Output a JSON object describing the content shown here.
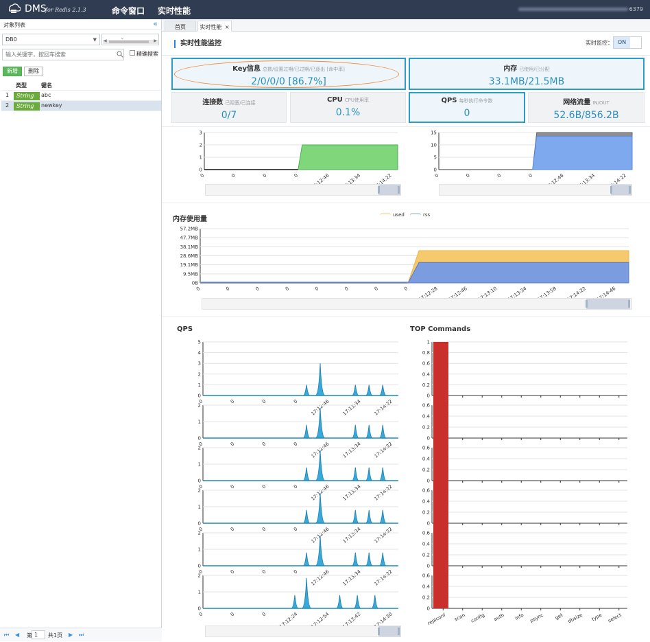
{
  "topbar": {
    "brand": "DMS",
    "brand_sub": "for Redis 2.1.3",
    "nav": [
      "命令窗口",
      "实时性能"
    ],
    "conn_suffix": "6379"
  },
  "sidebar": {
    "title": "对象列表",
    "collapse_icon": "double-chevron-left-icon",
    "db_value": "DB0",
    "search_placeholder": "输入关键字，按回车搜索",
    "exact_label": "精确搜索",
    "add_label": "新增",
    "delete_label": "删除",
    "columns": [
      "类型",
      "键名"
    ],
    "rows": [
      {
        "index": "1",
        "type": "String",
        "name": "abc"
      },
      {
        "index": "2",
        "type": "String",
        "name": "newkey"
      }
    ],
    "pager": {
      "page_prefix": "第",
      "page": "1",
      "total": "共1页"
    }
  },
  "tabs": [
    {
      "label": "首页"
    },
    {
      "label": "实时性能",
      "close": "×"
    }
  ],
  "main": {
    "title": "实时性能监控",
    "monitor_label": "实时监控：",
    "monitor_state": "ON",
    "cards": [
      {
        "title": "Key信息",
        "sub": "总数/设置过期/已过期/已逐出 [命中率]",
        "value": "2/0/0/0 [86.7%]"
      },
      {
        "title": "内存",
        "sub": "已使用/已分配",
        "value": "33.1MB/21.5MB"
      },
      {
        "title": "连接数",
        "sub": "已阻塞/已连接",
        "value": "0/7"
      },
      {
        "title": "CPU",
        "sub": "CPU使用率",
        "value": "0.1%"
      },
      {
        "title": "QPS",
        "sub": "每秒执行命令数",
        "value": "0"
      },
      {
        "title": "网络流量",
        "sub": "IN/OUT",
        "value": "52.6B/856.2B"
      }
    ],
    "memory_title": "内存使用量",
    "qps_title": "QPS",
    "top_title": "TOP Commands"
  },
  "chart_data": [
    {
      "type": "area",
      "name": "connections",
      "x": [
        "0",
        "0",
        "0",
        "0",
        "17:12:46",
        "17:13:34",
        "17:14:22"
      ],
      "values": [
        0,
        0,
        0,
        0,
        2,
        2,
        2
      ],
      "ylim": [
        0,
        3
      ],
      "yticks": [
        "0",
        "1",
        "2",
        "3"
      ],
      "color": "#7fd67b"
    },
    {
      "type": "area",
      "name": "cpu-network",
      "x": [
        "0",
        "0",
        "0",
        "0",
        "17:12:46",
        "17:13:34",
        "17:14:22"
      ],
      "series": [
        {
          "values": [
            0,
            0,
            0,
            0,
            15,
            15,
            15
          ],
          "color": "#8f8f8f"
        },
        {
          "values": [
            0,
            0,
            0,
            0,
            13.5,
            13.5,
            13.5
          ],
          "color": "#7fa9ee"
        }
      ],
      "ylim": [
        0,
        15
      ],
      "yticks": [
        "0",
        "5",
        "10",
        "15"
      ]
    },
    {
      "type": "area",
      "name": "memory",
      "x": [
        "0",
        "0",
        "0",
        "0",
        "0",
        "0",
        "0",
        "0",
        "17:12:28",
        "17:12:46",
        "17:13:10",
        "17:13:34",
        "17:13:58",
        "17:14:22",
        "17:14:46"
      ],
      "series": [
        {
          "name": "used",
          "values": [
            0,
            0,
            0,
            0,
            0,
            0,
            0,
            0,
            34,
            34,
            34,
            34,
            34,
            34,
            34
          ],
          "color": "#f5c96c"
        },
        {
          "name": "rss",
          "values": [
            0,
            0,
            0,
            0,
            0,
            0,
            0,
            0,
            21.5,
            21.5,
            21.5,
            21.5,
            21.5,
            21.5,
            21.5
          ],
          "color": "#7b9de0"
        }
      ],
      "yticks": [
        "0B",
        "9.5MB",
        "19.1MB",
        "28.6MB",
        "38.1MB",
        "47.7MB",
        "57.2MB"
      ],
      "ylim": [
        0,
        57.2
      ]
    },
    {
      "type": "area",
      "name": "qps-small-multiples",
      "x": [
        "0",
        "0",
        "0",
        "0",
        "17:12:46",
        "17:13:34",
        "17:14:22"
      ],
      "panels": [
        {
          "yticks": [
            "0",
            "1",
            "2",
            "3",
            "4",
            "5"
          ],
          "ymax": 5,
          "peaks": [
            [
              0.53,
              1
            ],
            [
              0.6,
              3
            ],
            [
              0.78,
              1
            ],
            [
              0.85,
              1
            ],
            [
              0.92,
              1
            ]
          ]
        },
        {
          "yticks": [
            "0",
            "1",
            "2"
          ],
          "ymax": 2.5,
          "peaks": [
            [
              0.53,
              1
            ],
            [
              0.6,
              2.3
            ],
            [
              0.78,
              1
            ],
            [
              0.85,
              1
            ],
            [
              0.92,
              1
            ]
          ]
        },
        {
          "yticks": [
            "0",
            "1",
            "2"
          ],
          "ymax": 2.5,
          "peaks": [
            [
              0.53,
              1
            ],
            [
              0.6,
              2.3
            ],
            [
              0.78,
              1
            ],
            [
              0.85,
              1
            ],
            [
              0.92,
              1
            ]
          ]
        },
        {
          "yticks": [
            "0",
            "1",
            "2"
          ],
          "ymax": 2.5,
          "peaks": [
            [
              0.53,
              1
            ],
            [
              0.6,
              2.3
            ],
            [
              0.78,
              1
            ],
            [
              0.85,
              1
            ],
            [
              0.92,
              1
            ]
          ]
        },
        {
          "yticks": [
            "0",
            "1",
            "2"
          ],
          "ymax": 2.5,
          "peaks": [
            [
              0.53,
              1
            ],
            [
              0.6,
              2.3
            ],
            [
              0.78,
              1
            ],
            [
              0.85,
              1
            ],
            [
              0.92,
              1
            ]
          ]
        },
        {
          "yticks": [
            "0",
            "1",
            "2"
          ],
          "ymax": 2.5,
          "x": [
            "0",
            "0",
            "0",
            "17:12:24",
            "17:12:54",
            "17:13:42",
            "17:14:30"
          ],
          "peaks": [
            [
              0.47,
              1
            ],
            [
              0.53,
              2.3
            ],
            [
              0.7,
              1
            ],
            [
              0.79,
              1
            ],
            [
              0.88,
              1
            ]
          ]
        }
      ],
      "color": "#3aa8d8"
    },
    {
      "type": "bar",
      "name": "top-commands",
      "categories": [
        "replconf",
        "scan",
        "config",
        "auth",
        "info",
        "psync",
        "get",
        "dbsize",
        "type",
        "select"
      ],
      "panels": [
        {
          "yticks": [
            "0",
            "0.2",
            "0.4",
            "0.6",
            "0.8",
            "1"
          ],
          "ymax": 1
        },
        {
          "yticks": [
            "0",
            "0.2",
            "0.4",
            "0.6"
          ],
          "ymax": 0.6
        },
        {
          "yticks": [
            "0",
            "0.2",
            "0.4",
            "0.6"
          ],
          "ymax": 0.6
        },
        {
          "yticks": [
            "0",
            "0.2",
            "0.4",
            "0.6"
          ],
          "ymax": 0.6
        },
        {
          "yticks": [
            "0",
            "0.2",
            "0.4",
            "0.6"
          ],
          "ymax": 0.6
        },
        {
          "yticks": [
            "0",
            "0.2",
            "0.4",
            "0.6"
          ],
          "ymax": 0.6
        }
      ],
      "values": [
        1,
        0,
        0,
        0,
        0,
        0,
        0,
        0,
        0,
        0
      ],
      "color": "#c9302c"
    }
  ]
}
